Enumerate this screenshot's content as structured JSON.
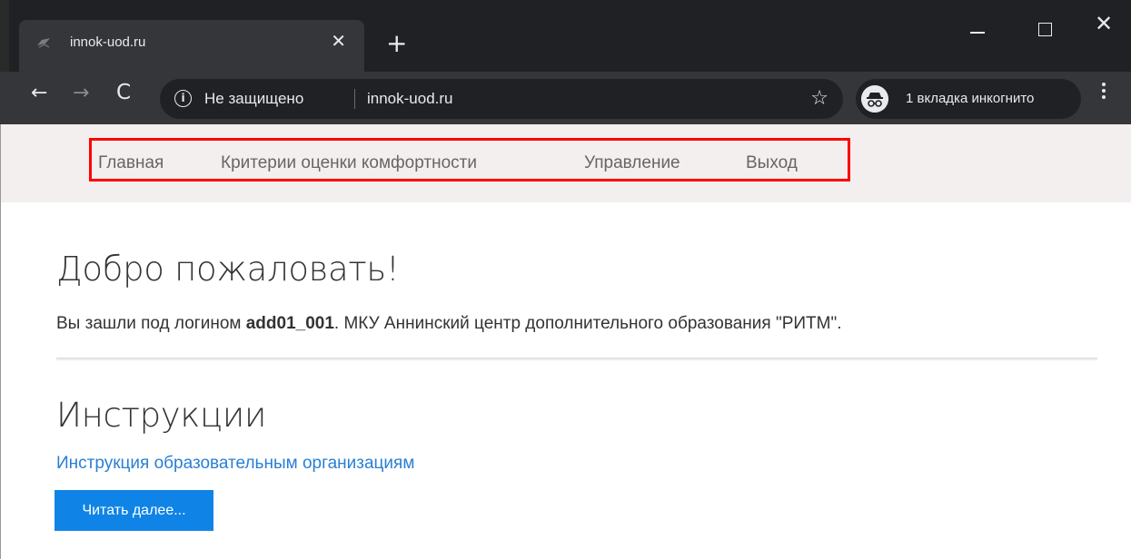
{
  "browser": {
    "tab_title": "innok-uod.ru",
    "tab_close": "✕",
    "new_tab": "+",
    "window_close": "✕",
    "nav_back": "←",
    "nav_forward": "→",
    "nav_reload": "C",
    "security_label": "Не защищено",
    "url": "innok-uod.ru",
    "info_icon": "i",
    "star_icon": "☆",
    "incognito_label": "1 вкладка инкогнито"
  },
  "site_nav": {
    "items": [
      "Главная",
      "Критерии оценки комфортности",
      "Управление",
      "Выход"
    ]
  },
  "main": {
    "welcome_title": "Добро пожаловать!",
    "login_prefix": "Вы зашли под логином ",
    "login_name": "add01_001",
    "login_suffix": ". МКУ Аннинский центр дополнительного образования \"РИТМ\".",
    "instructions_title": "Инструкции",
    "instructions_link": "Инструкция образовательным организациям",
    "read_more_button": "Читать далее..."
  },
  "colors": {
    "chrome_dark": "#202124",
    "chrome_toolbar": "#35363a",
    "nav_background": "#f3efee",
    "highlight_border": "#ff0000",
    "link": "#2a7fd4",
    "button": "#1084e6"
  }
}
